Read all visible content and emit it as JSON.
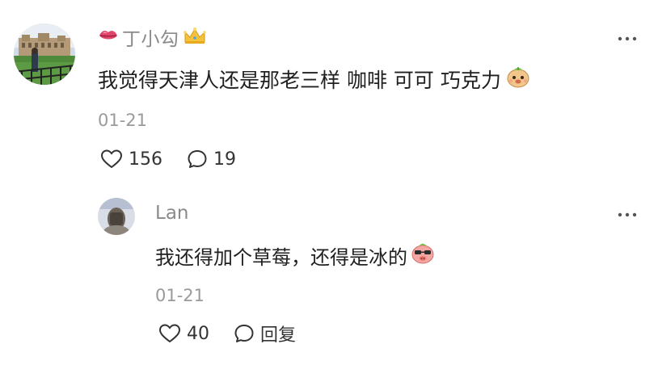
{
  "comment": {
    "username": "丁小勾",
    "username_prefix_icon": "lips-emoji-icon",
    "username_suffix_icon": "crown-emoji-icon",
    "text": "我觉得天津人还是那老三样 咖啡 可可 巧克力",
    "text_suffix_icon": "smiling-cat-emoji-icon",
    "date": "01-21",
    "likes": "156",
    "comments": "19"
  },
  "reply": {
    "username": "Lan",
    "text": "我还得加个草莓，还得是冰的",
    "text_suffix_icon": "cool-pig-emoji-icon",
    "date": "01-21",
    "likes": "40",
    "reply_label": "回复"
  },
  "colors": {
    "username": "#8a8a8a",
    "text": "#1f1f1f",
    "meta": "#9a9a9a"
  }
}
